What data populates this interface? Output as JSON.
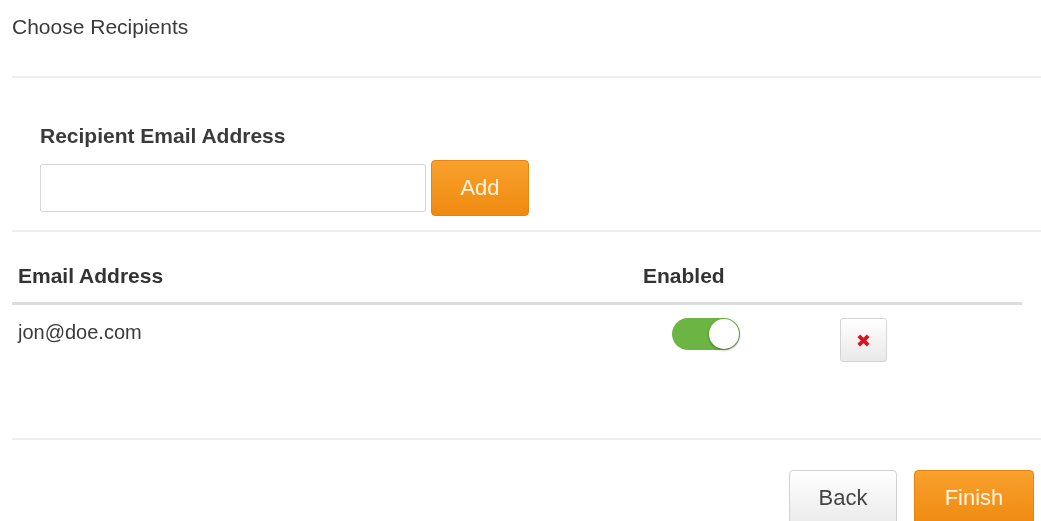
{
  "title": "Choose Recipients",
  "form": {
    "label": "Recipient Email Address",
    "add_button": "Add"
  },
  "table": {
    "columns": [
      "Email Address",
      "Enabled"
    ],
    "rows": [
      {
        "email": "jon@doe.com",
        "enabled": true
      }
    ]
  },
  "buttons": [
    {
      "label": "Back",
      "kind": "secondary"
    },
    {
      "label": "Finish",
      "kind": "primary"
    }
  ]
}
